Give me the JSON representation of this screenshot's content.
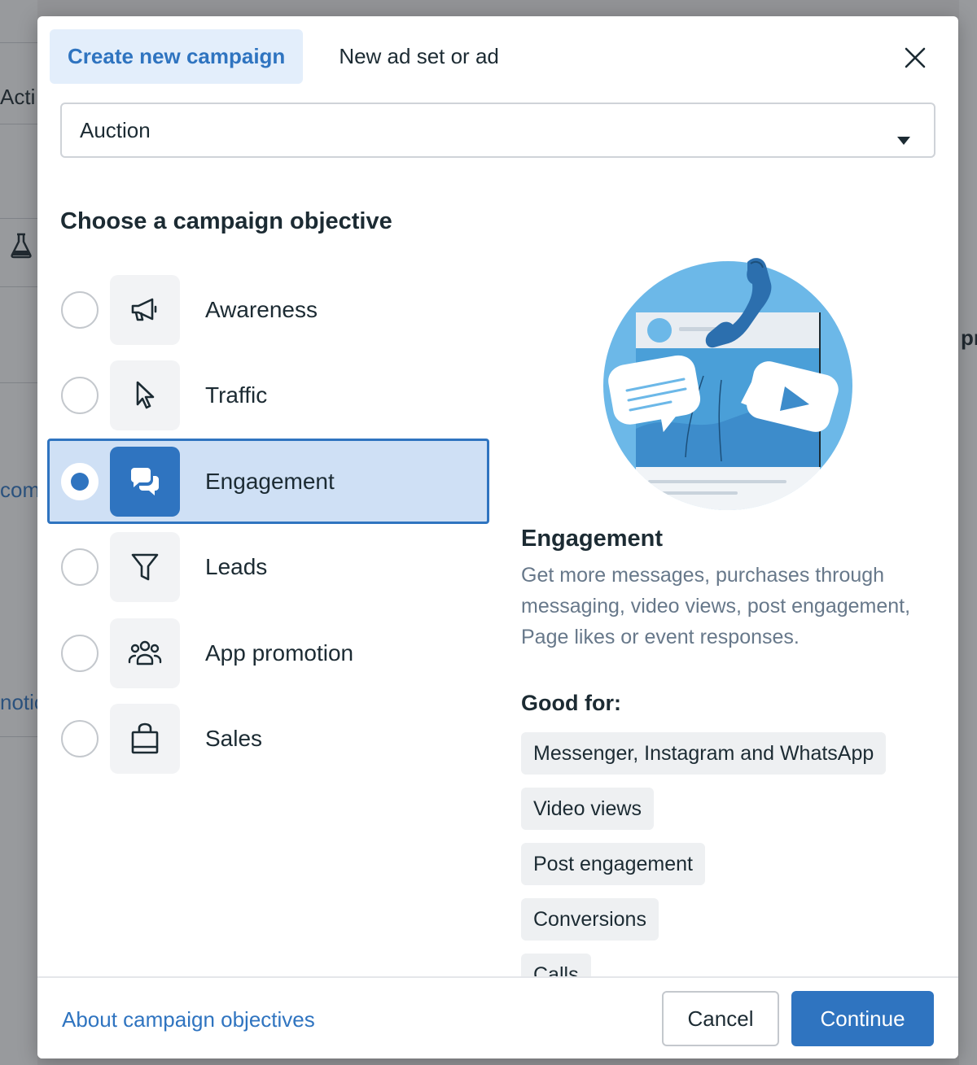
{
  "background": {
    "fragments": [
      "Acti",
      "comi",
      "notic",
      "pr"
    ]
  },
  "modal": {
    "tabs": [
      {
        "label": "Create new campaign",
        "active": true
      },
      {
        "label": "New ad set or ad",
        "active": false
      }
    ],
    "buying_type": {
      "value": "Auction"
    },
    "section_title": "Choose a campaign objective",
    "objectives": [
      {
        "label": "Awareness",
        "icon": "megaphone-icon",
        "selected": false
      },
      {
        "label": "Traffic",
        "icon": "cursor-icon",
        "selected": false
      },
      {
        "label": "Engagement",
        "icon": "chat-bubbles-icon",
        "selected": true
      },
      {
        "label": "Leads",
        "icon": "funnel-icon",
        "selected": false
      },
      {
        "label": "App promotion",
        "icon": "people-group-icon",
        "selected": false
      },
      {
        "label": "Sales",
        "icon": "shopping-bag-icon",
        "selected": false
      }
    ],
    "detail": {
      "title": "Engagement",
      "description": "Get more messages, purchases through messaging, video views, post engagement, Page likes or event responses.",
      "good_for_label": "Good for:",
      "good_for": [
        "Messenger, Instagram and WhatsApp",
        "Video views",
        "Post engagement",
        "Conversions",
        "Calls"
      ]
    },
    "footer": {
      "link": "About campaign objectives",
      "cancel": "Cancel",
      "continue": "Continue"
    },
    "colors": {
      "accent": "#2f74c0",
      "selected_bg": "#cfe0f5",
      "illustration_blue": "#6cb8e8"
    }
  }
}
